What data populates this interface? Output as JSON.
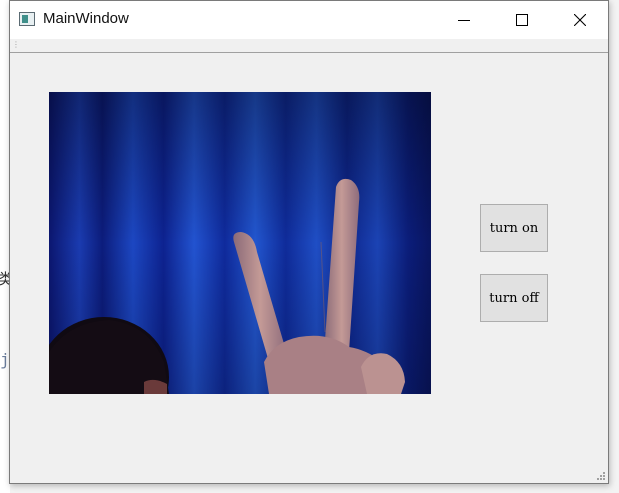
{
  "background_text": {
    "glyph_a": "类",
    "glyph_b": "j"
  },
  "window": {
    "title": "MainWindow",
    "icon": "app-window-icon",
    "controls": {
      "minimize_icon": "minimize-icon",
      "maximize_icon": "maximize-icon",
      "close_icon": "close-icon"
    }
  },
  "main": {
    "video_feed": {
      "description_icon": "camera-frame-image"
    },
    "buttons": {
      "turn_on_label": "turn on",
      "turn_off_label": "turn off"
    }
  },
  "colors": {
    "window_bg": "#f0f0f0",
    "titlebar_bg": "#ffffff",
    "button_bg": "#e1e1e1",
    "button_border": "#adadad",
    "video_blue": "#0a1a6e"
  }
}
